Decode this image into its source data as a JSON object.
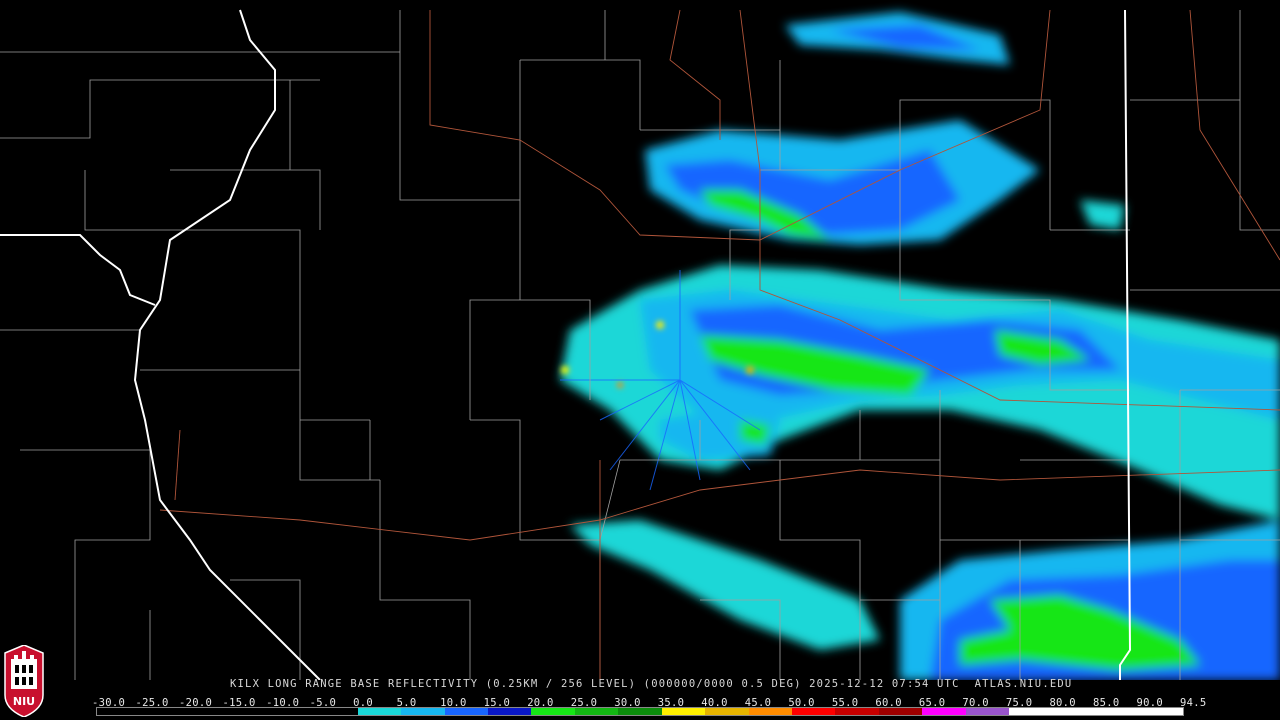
{
  "product": {
    "caption": "KILX LONG RANGE BASE REFLECTIVITY (0.25KM / 256 LEVEL) (000000/0000 0.5 DEG) 2025-12-12 07:54 UTC  ATLAS.NIU.EDU"
  },
  "logo": {
    "text": "NIU",
    "colors": {
      "red": "#c8102e",
      "black": "#000000",
      "white": "#ffffff"
    }
  },
  "colorbar": {
    "labels": [
      "-30.0",
      "-25.0",
      "-20.0",
      "-15.0",
      "-10.0",
      "-5.0",
      "0.0",
      "5.0",
      "10.0",
      "15.0",
      "20.0",
      "25.0",
      "30.0",
      "35.0",
      "40.0",
      "45.0",
      "50.0",
      "55.0",
      "60.0",
      "65.0",
      "70.0",
      "75.0",
      "80.0",
      "85.0",
      "90.0",
      "94.5"
    ],
    "colors": [
      "#000000",
      "#000000",
      "#000000",
      "#000000",
      "#000000",
      "#000000",
      "#1ad7d7",
      "#16b7f0",
      "#1866ff",
      "#0a18c8",
      "#16e616",
      "#13b713",
      "#0c8c0c",
      "#fff000",
      "#e6b400",
      "#ff8c00",
      "#ff0000",
      "#c80000",
      "#a00000",
      "#ff00ff",
      "#9955cc",
      "#ffffff",
      "#ffffff",
      "#ffffff",
      "#ffffff"
    ]
  },
  "map_colors": {
    "state_border": "#ffffff",
    "county_border": "#a0a0a0",
    "highway": "#b0553a",
    "background": "#000000"
  }
}
